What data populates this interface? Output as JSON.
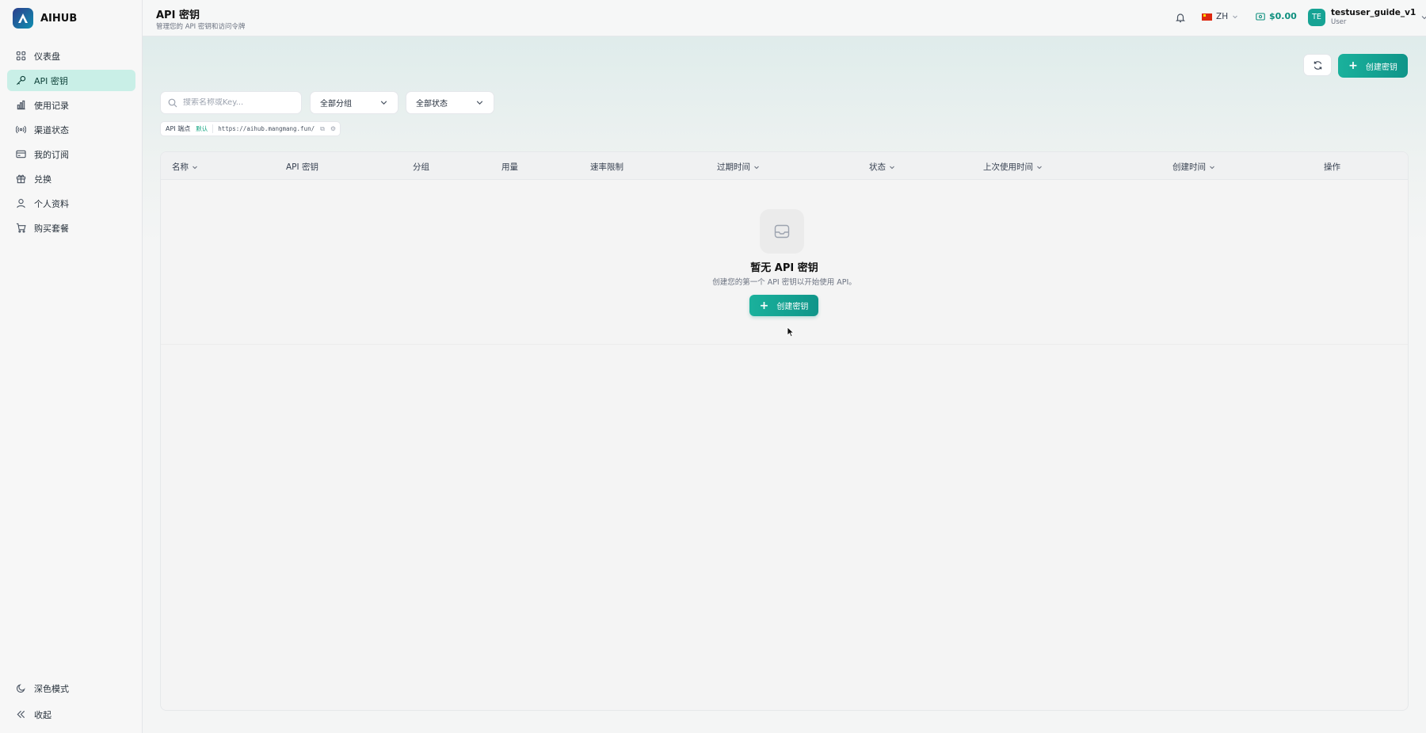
{
  "brand": {
    "name": "AIHUB"
  },
  "sidebar": {
    "items": [
      {
        "label": "仪表盘",
        "icon": "dashboard-icon",
        "active": false
      },
      {
        "label": "API 密钥",
        "icon": "key-icon",
        "active": true
      },
      {
        "label": "使用记录",
        "icon": "bar-chart-icon",
        "active": false
      },
      {
        "label": "渠道状态",
        "icon": "broadcast-icon",
        "active": false
      },
      {
        "label": "我的订阅",
        "icon": "credit-card-icon",
        "active": false
      },
      {
        "label": "兑换",
        "icon": "gift-icon",
        "active": false
      },
      {
        "label": "个人资料",
        "icon": "user-icon",
        "active": false
      },
      {
        "label": "购买套餐",
        "icon": "cart-icon",
        "active": false
      }
    ],
    "dark_mode_label": "深色模式",
    "collapse_label": "收起"
  },
  "header": {
    "title": "API 密钥",
    "subtitle": "管理您的 API 密钥和访问令牌",
    "language": "ZH",
    "balance": "$0.00",
    "user": {
      "initials": "TE",
      "name": "testuser_guide_v1",
      "role": "User"
    }
  },
  "toolbar": {
    "create_label": "创建密钥",
    "search_placeholder": "搜索名称或Key...",
    "group_filter": "全部分组",
    "status_filter": "全部状态"
  },
  "endpoint": {
    "label": "API 端点",
    "tag": "默认",
    "url": "https://aihub.mangmang.fun/"
  },
  "table": {
    "columns": [
      {
        "label": "名称",
        "sortable": true
      },
      {
        "label": "API 密钥",
        "sortable": false
      },
      {
        "label": "分组",
        "sortable": false
      },
      {
        "label": "用量",
        "sortable": false
      },
      {
        "label": "速率限制",
        "sortable": false
      },
      {
        "label": "过期时间",
        "sortable": true
      },
      {
        "label": "状态",
        "sortable": true
      },
      {
        "label": "上次使用时间",
        "sortable": true
      },
      {
        "label": "创建时间",
        "sortable": true
      },
      {
        "label": "操作",
        "sortable": false
      }
    ],
    "empty": {
      "title": "暂无 API 密钥",
      "description": "创建您的第一个 API 密钥以开始使用 API。",
      "button_label": "创建密钥"
    }
  },
  "colors": {
    "accent": "#14a38f",
    "active_nav_bg": "#c9efe7"
  }
}
